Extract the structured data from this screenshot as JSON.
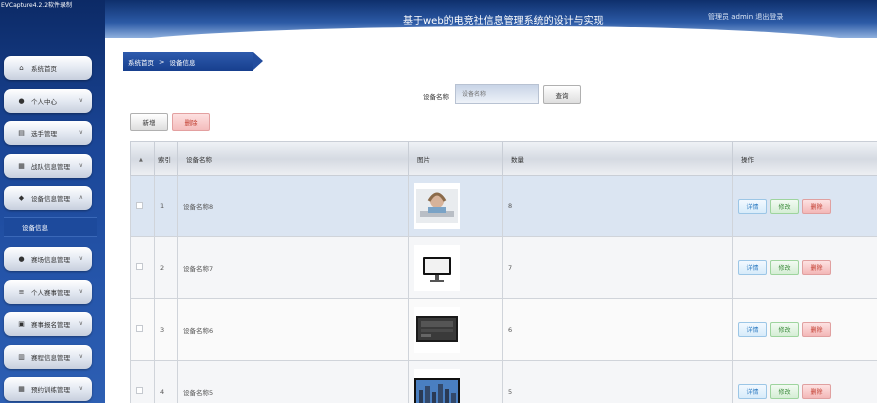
{
  "capture_label": "EVCapture4.2.2软件录制",
  "header": {
    "title": "基于web的电竞社信息管理系统的设计与实现",
    "user_text": "管理员 admin  退出登录"
  },
  "sidebar": {
    "items": [
      {
        "label": "系统首页",
        "icon": "home-icon",
        "chevron": false
      },
      {
        "label": "个人中心",
        "icon": "user-icon",
        "chevron": true
      },
      {
        "label": "选手管理",
        "icon": "list-icon",
        "chevron": true
      },
      {
        "label": "战队信息管理",
        "icon": "grid-icon",
        "chevron": true
      },
      {
        "label": "设备信息管理",
        "icon": "pin-icon",
        "chevron": true
      },
      {
        "label": "赛场信息管理",
        "icon": "user-icon",
        "chevron": true
      },
      {
        "label": "个人赛事管理",
        "icon": "menu-icon",
        "chevron": true
      },
      {
        "label": "赛事报名管理",
        "icon": "clipboard-icon",
        "chevron": true
      },
      {
        "label": "赛程信息管理",
        "icon": "chart-icon",
        "chevron": true
      },
      {
        "label": "预约训练管理",
        "icon": "grid-icon",
        "chevron": true
      }
    ],
    "submenu_label": "设备信息"
  },
  "breadcrumb": {
    "home": "系统首页",
    "separator": ">",
    "current": "设备信息"
  },
  "search": {
    "label": "设备名称",
    "placeholder": "设备名称",
    "button": "查询"
  },
  "toolbar": {
    "add": "新增",
    "delete": "删除"
  },
  "table": {
    "headers": {
      "index": "索引",
      "name": "设备名称",
      "image": "图片",
      "count": "数量",
      "actions": "操作"
    },
    "sort_glyph": "▲",
    "rows": [
      {
        "index": "1",
        "name": "设备名称8",
        "image": "headset-photo",
        "count": "8"
      },
      {
        "index": "2",
        "name": "设备名称7",
        "image": "monitor-photo",
        "count": "7"
      },
      {
        "index": "3",
        "name": "设备名称6",
        "image": "tv-photo",
        "count": "6"
      },
      {
        "index": "4",
        "name": "设备名称5",
        "image": "city-screen-photo",
        "count": "5"
      }
    ],
    "actions": {
      "detail": "详情",
      "edit": "修改",
      "delete": "删除"
    }
  },
  "colors": {
    "sidebar": "#1a4596",
    "header": "#2c5aa6",
    "selected_row": "#dbe5f2",
    "delete": "#c0392b"
  }
}
